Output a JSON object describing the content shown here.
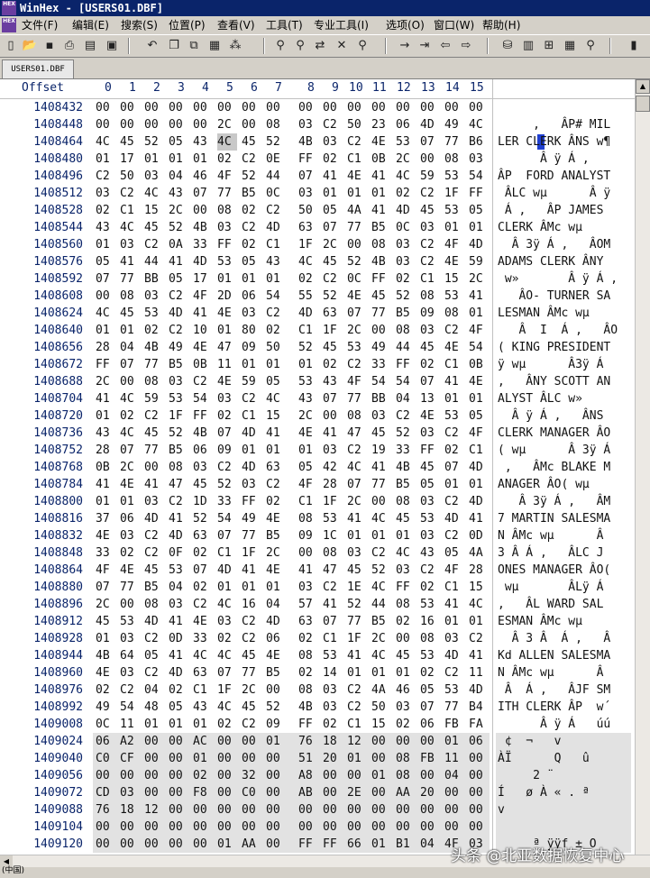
{
  "window": {
    "title": "WinHex - [USERS01.DBF]",
    "app_icon_text": "HEX"
  },
  "menu": [
    "文件(F)",
    "编辑(E)",
    "搜索(S)",
    "位置(P)",
    "查看(V)",
    "工具(T)",
    "专业工具(I)",
    "选项(O)",
    "窗口(W)",
    "帮助(H)"
  ],
  "toolbar": {
    "icons": [
      "new-file-icon",
      "open-icon",
      "save-icon",
      "print-icon",
      "properties-icon",
      "open-folder-icon",
      "undo-icon",
      "copy-block-icon",
      "copy-icon",
      "paste-icon",
      "paste-hex-icon",
      "write-icon",
      "find-text-icon",
      "find-hex-icon",
      "replace-text-icon",
      "replace-hex-icon",
      "find-icon",
      "goto-offset-icon",
      "goto-page-icon",
      "back-icon",
      "forward-icon",
      "disk-icon",
      "ram-icon",
      "file-compare-icon",
      "calculator-icon",
      "view-icon"
    ]
  },
  "tab": {
    "label": "USERS01.DBF"
  },
  "header": {
    "offset_label": "Offset",
    "columns": [
      "0",
      "1",
      "2",
      "3",
      "4",
      "5",
      "6",
      "7",
      "8",
      "9",
      "10",
      "11",
      "12",
      "13",
      "14",
      "15"
    ]
  },
  "rows": [
    {
      "offset": "1408432",
      "bytes": [
        "00",
        "00",
        "00",
        "00",
        "00",
        "00",
        "00",
        "00",
        "00",
        "00",
        "00",
        "00",
        "00",
        "00",
        "00",
        "00"
      ],
      "ascii": ""
    },
    {
      "offset": "1408448",
      "bytes": [
        "00",
        "00",
        "00",
        "00",
        "00",
        "2C",
        "00",
        "08",
        "03",
        "C2",
        "50",
        "23",
        "06",
        "4D",
        "49",
        "4C"
      ],
      "ascii": "     ,   ÂP# MIL"
    },
    {
      "offset": "1408464",
      "bytes": [
        "4C",
        "45",
        "52",
        "05",
        "43",
        "4C",
        "45",
        "52",
        "4B",
        "03",
        "C2",
        "4E",
        "53",
        "07",
        "77",
        "B6"
      ],
      "ascii": "LER CLERK ÂNS w¶"
    },
    {
      "offset": "1408480",
      "bytes": [
        "01",
        "17",
        "01",
        "01",
        "01",
        "02",
        "C2",
        "0E",
        "FF",
        "02",
        "C1",
        "0B",
        "2C",
        "00",
        "08",
        "03"
      ],
      "ascii": "      Â ÿ Á ,   "
    },
    {
      "offset": "1408496",
      "bytes": [
        "C2",
        "50",
        "03",
        "04",
        "46",
        "4F",
        "52",
        "44",
        "07",
        "41",
        "4E",
        "41",
        "4C",
        "59",
        "53",
        "54"
      ],
      "ascii": "ÂP  FORD ANALYST"
    },
    {
      "offset": "1408512",
      "bytes": [
        "03",
        "C2",
        "4C",
        "43",
        "07",
        "77",
        "B5",
        "0C",
        "03",
        "01",
        "01",
        "01",
        "02",
        "C2",
        "1F",
        "FF"
      ],
      "ascii": " ÂLC wµ      Â ÿ"
    },
    {
      "offset": "1408528",
      "bytes": [
        "02",
        "C1",
        "15",
        "2C",
        "00",
        "08",
        "02",
        "C2",
        "50",
        "05",
        "4A",
        "41",
        "4D",
        "45",
        "53",
        "05"
      ],
      "ascii": " Á ,   ÂP JAMES "
    },
    {
      "offset": "1408544",
      "bytes": [
        "43",
        "4C",
        "45",
        "52",
        "4B",
        "03",
        "C2",
        "4D",
        "63",
        "07",
        "77",
        "B5",
        "0C",
        "03",
        "01",
        "01"
      ],
      "ascii": "CLERK ÂMc wµ    "
    },
    {
      "offset": "1408560",
      "bytes": [
        "01",
        "03",
        "C2",
        "0A",
        "33",
        "FF",
        "02",
        "C1",
        "1F",
        "2C",
        "00",
        "08",
        "03",
        "C2",
        "4F",
        "4D"
      ],
      "ascii": "  Â 3ÿ Á ,   ÂOM"
    },
    {
      "offset": "1408576",
      "bytes": [
        "05",
        "41",
        "44",
        "41",
        "4D",
        "53",
        "05",
        "43",
        "4C",
        "45",
        "52",
        "4B",
        "03",
        "C2",
        "4E",
        "59"
      ],
      "ascii": "ADAMS CLERK ÂNY"
    },
    {
      "offset": "1408592",
      "bytes": [
        "07",
        "77",
        "BB",
        "05",
        "17",
        "01",
        "01",
        "01",
        "02",
        "C2",
        "0C",
        "FF",
        "02",
        "C1",
        "15",
        "2C"
      ],
      "ascii": " w»       Â ÿ Á ,"
    },
    {
      "offset": "1408608",
      "bytes": [
        "00",
        "08",
        "03",
        "C2",
        "4F",
        "2D",
        "06",
        "54",
        "55",
        "52",
        "4E",
        "45",
        "52",
        "08",
        "53",
        "41"
      ],
      "ascii": "   ÂO- TURNER SA"
    },
    {
      "offset": "1408624",
      "bytes": [
        "4C",
        "45",
        "53",
        "4D",
        "41",
        "4E",
        "03",
        "C2",
        "4D",
        "63",
        "07",
        "77",
        "B5",
        "09",
        "08",
        "01"
      ],
      "ascii": "LESMAN ÂMc wµ   "
    },
    {
      "offset": "1408640",
      "bytes": [
        "01",
        "01",
        "02",
        "C2",
        "10",
        "01",
        "80",
        "02",
        "C1",
        "1F",
        "2C",
        "00",
        "08",
        "03",
        "C2",
        "4F"
      ],
      "ascii": "   Â  I  Á ,   ÂO"
    },
    {
      "offset": "1408656",
      "bytes": [
        "28",
        "04",
        "4B",
        "49",
        "4E",
        "47",
        "09",
        "50",
        "52",
        "45",
        "53",
        "49",
        "44",
        "45",
        "4E",
        "54"
      ],
      "ascii": "( KING PRESIDENT"
    },
    {
      "offset": "1408672",
      "bytes": [
        "FF",
        "07",
        "77",
        "B5",
        "0B",
        "11",
        "01",
        "01",
        "01",
        "02",
        "C2",
        "33",
        "FF",
        "02",
        "C1",
        "0B"
      ],
      "ascii": "ÿ wµ      Â3ÿ Á "
    },
    {
      "offset": "1408688",
      "bytes": [
        "2C",
        "00",
        "08",
        "03",
        "C2",
        "4E",
        "59",
        "05",
        "53",
        "43",
        "4F",
        "54",
        "54",
        "07",
        "41",
        "4E"
      ],
      "ascii": ",   ÂNY SCOTT AN"
    },
    {
      "offset": "1408704",
      "bytes": [
        "41",
        "4C",
        "59",
        "53",
        "54",
        "03",
        "C2",
        "4C",
        "43",
        "07",
        "77",
        "BB",
        "04",
        "13",
        "01",
        "01"
      ],
      "ascii": "ALYST ÂLC w»    "
    },
    {
      "offset": "1408720",
      "bytes": [
        "01",
        "02",
        "C2",
        "1F",
        "FF",
        "02",
        "C1",
        "15",
        "2C",
        "00",
        "08",
        "03",
        "C2",
        "4E",
        "53",
        "05"
      ],
      "ascii": "  Â ÿ Á ,   ÂNS "
    },
    {
      "offset": "1408736",
      "bytes": [
        "43",
        "4C",
        "45",
        "52",
        "4B",
        "07",
        "4D",
        "41",
        "4E",
        "41",
        "47",
        "45",
        "52",
        "03",
        "C2",
        "4F"
      ],
      "ascii": "CLERK MANAGER ÂO"
    },
    {
      "offset": "1408752",
      "bytes": [
        "28",
        "07",
        "77",
        "B5",
        "06",
        "09",
        "01",
        "01",
        "01",
        "03",
        "C2",
        "19",
        "33",
        "FF",
        "02",
        "C1"
      ],
      "ascii": "( wµ      Â 3ÿ Á"
    },
    {
      "offset": "1408768",
      "bytes": [
        "0B",
        "2C",
        "00",
        "08",
        "03",
        "C2",
        "4D",
        "63",
        "05",
        "42",
        "4C",
        "41",
        "4B",
        "45",
        "07",
        "4D"
      ],
      "ascii": " ,   ÂMc BLAKE M"
    },
    {
      "offset": "1408784",
      "bytes": [
        "41",
        "4E",
        "41",
        "47",
        "45",
        "52",
        "03",
        "C2",
        "4F",
        "28",
        "07",
        "77",
        "B5",
        "05",
        "01",
        "01"
      ],
      "ascii": "ANAGER ÂO( wµ   "
    },
    {
      "offset": "1408800",
      "bytes": [
        "01",
        "01",
        "03",
        "C2",
        "1D",
        "33",
        "FF",
        "02",
        "C1",
        "1F",
        "2C",
        "00",
        "08",
        "03",
        "C2",
        "4D"
      ],
      "ascii": "   Â 3ÿ Á ,   ÂM"
    },
    {
      "offset": "1408816",
      "bytes": [
        "37",
        "06",
        "4D",
        "41",
        "52",
        "54",
        "49",
        "4E",
        "08",
        "53",
        "41",
        "4C",
        "45",
        "53",
        "4D",
        "41"
      ],
      "ascii": "7 MARTIN SALESMA"
    },
    {
      "offset": "1408832",
      "bytes": [
        "4E",
        "03",
        "C2",
        "4D",
        "63",
        "07",
        "77",
        "B5",
        "09",
        "1C",
        "01",
        "01",
        "01",
        "03",
        "C2",
        "0D"
      ],
      "ascii": "N ÂMc wµ      Â "
    },
    {
      "offset": "1408848",
      "bytes": [
        "33",
        "02",
        "C2",
        "0F",
        "02",
        "C1",
        "1F",
        "2C",
        "00",
        "08",
        "03",
        "C2",
        "4C",
        "43",
        "05",
        "4A"
      ],
      "ascii": "3 Â Á ,   ÂLC J"
    },
    {
      "offset": "1408864",
      "bytes": [
        "4F",
        "4E",
        "45",
        "53",
        "07",
        "4D",
        "41",
        "4E",
        "41",
        "47",
        "45",
        "52",
        "03",
        "C2",
        "4F",
        "28"
      ],
      "ascii": "ONES MANAGER ÂO("
    },
    {
      "offset": "1408880",
      "bytes": [
        "07",
        "77",
        "B5",
        "04",
        "02",
        "01",
        "01",
        "01",
        "03",
        "C2",
        "1E",
        "4C",
        "FF",
        "02",
        "C1",
        "15"
      ],
      "ascii": " wµ       ÂLÿ Á "
    },
    {
      "offset": "1408896",
      "bytes": [
        "2C",
        "00",
        "08",
        "03",
        "C2",
        "4C",
        "16",
        "04",
        "57",
        "41",
        "52",
        "44",
        "08",
        "53",
        "41",
        "4C"
      ],
      "ascii": ",   ÂL WARD SAL"
    },
    {
      "offset": "1408912",
      "bytes": [
        "45",
        "53",
        "4D",
        "41",
        "4E",
        "03",
        "C2",
        "4D",
        "63",
        "07",
        "77",
        "B5",
        "02",
        "16",
        "01",
        "01"
      ],
      "ascii": "ESMAN ÂMc wµ    "
    },
    {
      "offset": "1408928",
      "bytes": [
        "01",
        "03",
        "C2",
        "0D",
        "33",
        "02",
        "C2",
        "06",
        "02",
        "C1",
        "1F",
        "2C",
        "00",
        "08",
        "03",
        "C2"
      ],
      "ascii": "  Â 3 Â  Á ,   Â"
    },
    {
      "offset": "1408944",
      "bytes": [
        "4B",
        "64",
        "05",
        "41",
        "4C",
        "4C",
        "45",
        "4E",
        "08",
        "53",
        "41",
        "4C",
        "45",
        "53",
        "4D",
        "41"
      ],
      "ascii": "Kd ALLEN SALESMA"
    },
    {
      "offset": "1408960",
      "bytes": [
        "4E",
        "03",
        "C2",
        "4D",
        "63",
        "07",
        "77",
        "B5",
        "02",
        "14",
        "01",
        "01",
        "01",
        "02",
        "C2",
        "11"
      ],
      "ascii": "N ÂMc wµ      Â "
    },
    {
      "offset": "1408976",
      "bytes": [
        "02",
        "C2",
        "04",
        "02",
        "C1",
        "1F",
        "2C",
        "00",
        "08",
        "03",
        "C2",
        "4A",
        "46",
        "05",
        "53",
        "4D"
      ],
      "ascii": " Â  Á ,   ÂJF SM"
    },
    {
      "offset": "1408992",
      "bytes": [
        "49",
        "54",
        "48",
        "05",
        "43",
        "4C",
        "45",
        "52",
        "4B",
        "03",
        "C2",
        "50",
        "03",
        "07",
        "77",
        "B4"
      ],
      "ascii": "ITH CLERK ÂP  w´"
    },
    {
      "offset": "1409008",
      "bytes": [
        "0C",
        "11",
        "01",
        "01",
        "01",
        "02",
        "C2",
        "09",
        "FF",
        "02",
        "C1",
        "15",
        "02",
        "06",
        "FB",
        "FA"
      ],
      "ascii": "      Â ÿ Á   úú"
    },
    {
      "offset": "1409024",
      "bytes": [
        "06",
        "A2",
        "00",
        "00",
        "AC",
        "00",
        "00",
        "01",
        "76",
        "18",
        "12",
        "00",
        "00",
        "00",
        "01",
        "06"
      ],
      "ascii": " ¢  ¬   v       "
    },
    {
      "offset": "1409040",
      "bytes": [
        "C0",
        "CF",
        "00",
        "00",
        "01",
        "00",
        "00",
        "00",
        "51",
        "20",
        "01",
        "00",
        "08",
        "FB",
        "11",
        "00"
      ],
      "ascii": "ÀÏ      Q   û   "
    },
    {
      "offset": "1409056",
      "bytes": [
        "00",
        "00",
        "00",
        "00",
        "02",
        "00",
        "32",
        "00",
        "A8",
        "00",
        "00",
        "01",
        "08",
        "00",
        "04",
        "00"
      ],
      "ascii": "     2 ¨        "
    },
    {
      "offset": "1409072",
      "bytes": [
        "CD",
        "03",
        "00",
        "00",
        "F8",
        "00",
        "C0",
        "00",
        "AB",
        "00",
        "2E",
        "00",
        "AA",
        "20",
        "00",
        "00"
      ],
      "ascii": "Í   ø À « . ª   "
    },
    {
      "offset": "1409088",
      "bytes": [
        "76",
        "18",
        "12",
        "00",
        "00",
        "00",
        "00",
        "00",
        "00",
        "00",
        "00",
        "00",
        "00",
        "00",
        "00",
        "00"
      ],
      "ascii": "v               "
    },
    {
      "offset": "1409104",
      "bytes": [
        "00",
        "00",
        "00",
        "00",
        "00",
        "00",
        "00",
        "00",
        "00",
        "00",
        "00",
        "00",
        "00",
        "00",
        "00",
        "00"
      ],
      "ascii": "                "
    },
    {
      "offset": "1409120",
      "bytes": [
        "00",
        "00",
        "00",
        "00",
        "00",
        "01",
        "AA",
        "00",
        "FF",
        "FF",
        "66",
        "01",
        "B1",
        "04",
        "4F",
        "03"
      ],
      "ascii": "     ª ÿÿf ± O "
    }
  ],
  "status": {
    "text": "(中国)"
  },
  "watermark": {
    "text": "头条 @北亚数据恢复中心"
  }
}
